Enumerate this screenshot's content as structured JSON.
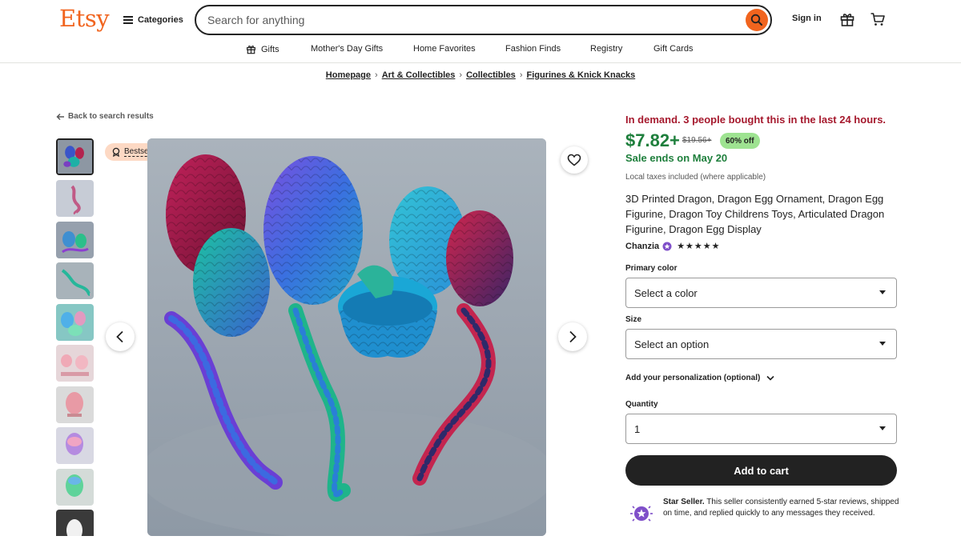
{
  "header": {
    "logo": "Etsy",
    "categories_label": "Categories",
    "search_placeholder": "Search for anything",
    "signin_label": "Sign in"
  },
  "nav": {
    "items": [
      "Gifts",
      "Mother's Day Gifts",
      "Home Favorites",
      "Fashion Finds",
      "Registry",
      "Gift Cards"
    ]
  },
  "breadcrumb": [
    "Homepage",
    "Art & Collectibles",
    "Collectibles",
    "Figurines & Knick Knacks"
  ],
  "back_label": "Back to search results",
  "gallery": {
    "badge": "Bestseller",
    "thumbnail_count": 10,
    "selected_thumbnail": 0
  },
  "product": {
    "demand": "In demand. 3 people bought this in the last 24 hours.",
    "price": "$7.82+",
    "original_price": "$19.56+",
    "discount": "60% off",
    "sale_ends": "Sale ends on May 20",
    "taxes": "Local taxes included (where applicable)",
    "title": "3D Printed Dragon, Dragon Egg Ornament, Dragon Egg Figurine, Dragon Toy Childrens Toys, Articulated Dragon Figurine, Dragon Egg Display",
    "shop_name": "Chanzia",
    "rating_stars": "★★★★★",
    "rating": 5
  },
  "options": {
    "primary_color_label": "Primary color",
    "primary_color_value": "Select a color",
    "size_label": "Size",
    "size_value": "Select an option",
    "personalization_label": "Add your personalization (optional)",
    "quantity_label": "Quantity",
    "quantity_value": "1"
  },
  "add_to_cart_label": "Add to cart",
  "star_seller": {
    "title": "Star Seller.",
    "text": " This seller consistently earned 5-star reviews, shipped on time, and replied quickly to any messages they received."
  },
  "colors": {
    "brand": "#F1641E",
    "demand": "#A61A2E",
    "price_green": "#1E7F3C",
    "discount_bg": "#9EE391",
    "badge_bg": "#FDD9C4",
    "star_seller_purple": "#7F4FC9"
  }
}
